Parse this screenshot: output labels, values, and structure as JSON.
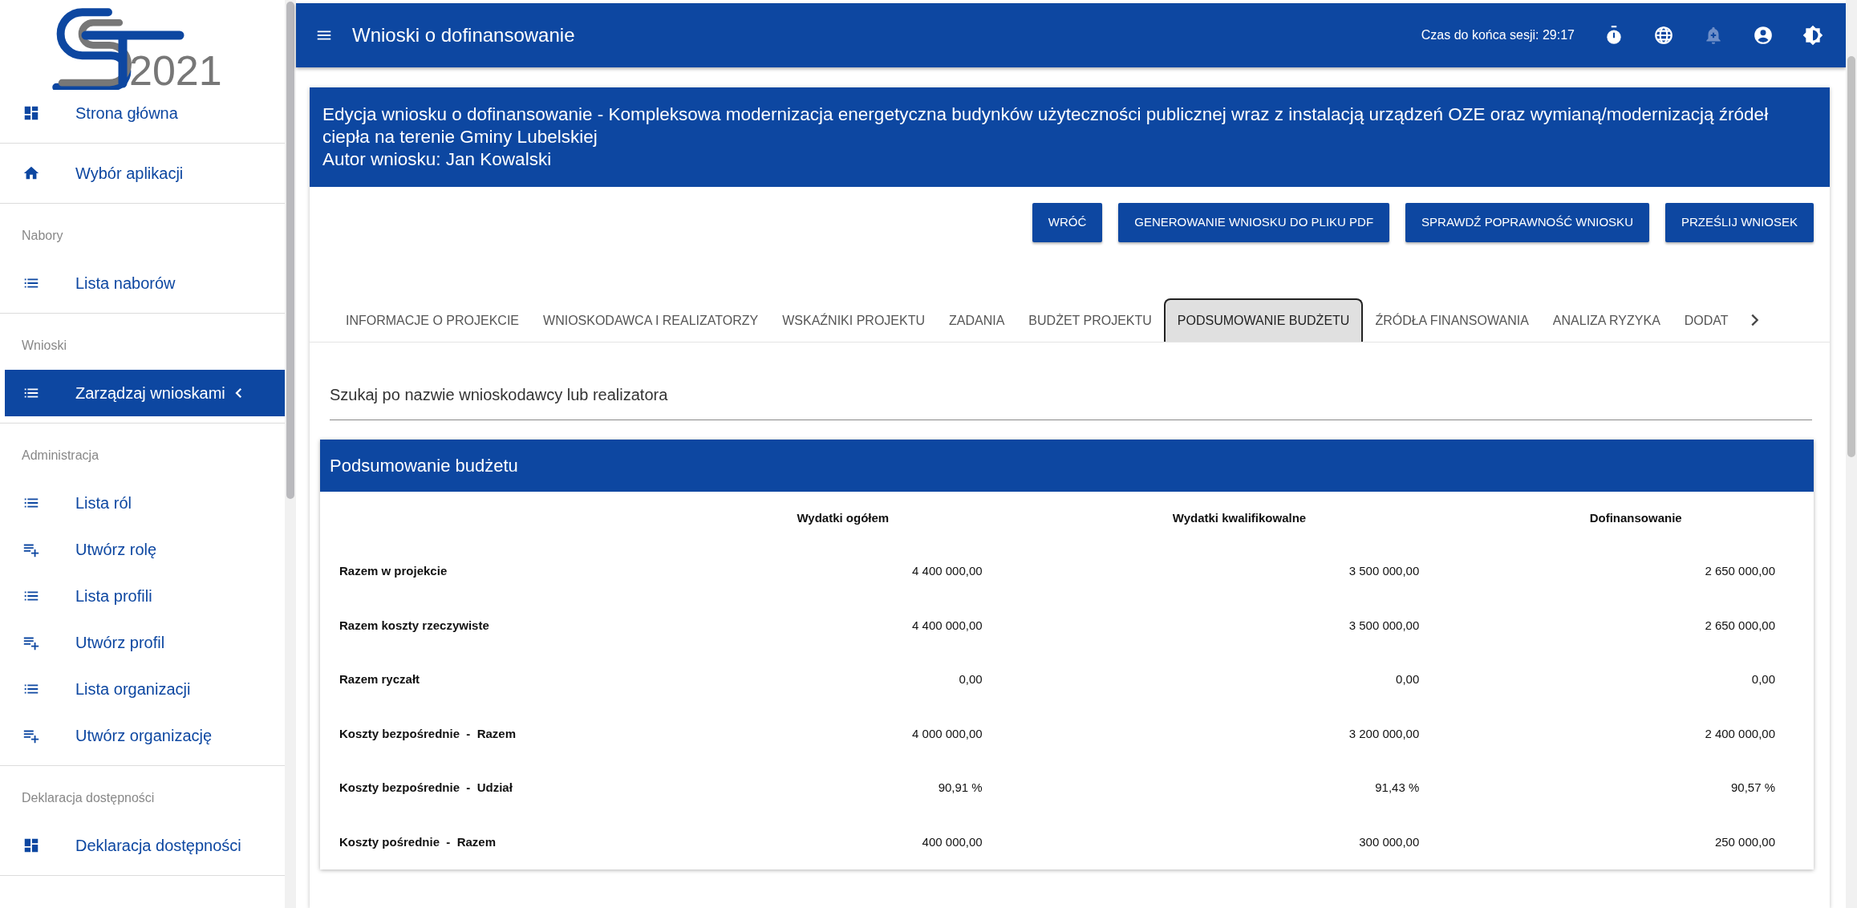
{
  "logo": {
    "text": "2021"
  },
  "sidebar": {
    "groups": [
      {
        "items": [
          {
            "kind": "dashboard",
            "label": "Strona główna",
            "selected": false,
            "has_submenu": false
          }
        ]
      },
      {
        "items": [
          {
            "kind": "home",
            "label": "Wybór aplikacji",
            "selected": false,
            "has_submenu": false
          }
        ]
      },
      {
        "header": "Nabory",
        "items": [
          {
            "kind": "list",
            "label": "Lista naborów",
            "selected": false,
            "has_submenu": false
          }
        ]
      },
      {
        "header": "Wnioski",
        "items": [
          {
            "kind": "list",
            "label": "Zarządzaj wnioskami",
            "selected": true,
            "has_submenu": true
          }
        ]
      },
      {
        "header": "Administracja",
        "items": [
          {
            "kind": "list",
            "label": "Lista ról",
            "selected": false,
            "has_submenu": false
          },
          {
            "kind": "list-add",
            "label": "Utwórz rolę",
            "selected": false,
            "has_submenu": false
          },
          {
            "kind": "list",
            "label": "Lista profili",
            "selected": false,
            "has_submenu": false
          },
          {
            "kind": "list-add",
            "label": "Utwórz profil",
            "selected": false,
            "has_submenu": false
          },
          {
            "kind": "list",
            "label": "Lista organizacji",
            "selected": false,
            "has_submenu": false
          },
          {
            "kind": "list-add",
            "label": "Utwórz organizację",
            "selected": false,
            "has_submenu": false
          }
        ]
      },
      {
        "header": "Deklaracja dostępności",
        "items": [
          {
            "kind": "dashboard",
            "label": "Deklaracja dostępności",
            "selected": false,
            "has_submenu": false
          }
        ]
      }
    ]
  },
  "topbar": {
    "title": "Wnioski o dofinansowanie",
    "session": "Czas do końca sesji: 29:17",
    "icons": [
      {
        "kind": "timer",
        "disabled": false
      },
      {
        "kind": "globe",
        "disabled": false
      },
      {
        "kind": "bell",
        "disabled": true
      },
      {
        "kind": "account",
        "disabled": false
      },
      {
        "kind": "contrast",
        "disabled": false
      }
    ]
  },
  "header": {
    "title": "Edycja wniosku o dofinansowanie - Kompleksowa modernizacja energetyczna budynków użyteczności publicznej wraz z instalacją urządzeń OZE oraz wymianą/modernizacją źródeł ciepła na terenie Gminy Lubelskiej",
    "author": "Autor wniosku: Jan Kowalski"
  },
  "buttons": [
    "WRÓĆ",
    "GENEROWANIE WNIOSKU DO PLIKU PDF",
    "SPRAWDŹ POPRAWNOŚĆ WNIOSKU",
    "PRZEŚLIJ WNIOSEK"
  ],
  "tabs": [
    {
      "label": "INFORMACJE O PROJEKCIE",
      "selected": false
    },
    {
      "label": "WNIOSKODAWCA I REALIZATORZY",
      "selected": false
    },
    {
      "label": "WSKAŹNIKI PROJEKTU",
      "selected": false
    },
    {
      "label": "ZADANIA",
      "selected": false
    },
    {
      "label": "BUDŻET PROJEKTU",
      "selected": false
    },
    {
      "label": "PODSUMOWANIE BUDŻETU",
      "selected": true
    },
    {
      "label": "ŹRÓDŁA FINANSOWANIA",
      "selected": false
    },
    {
      "label": "ANALIZA RYZYKA",
      "selected": false
    },
    {
      "label": "DODAT",
      "selected": false
    }
  ],
  "search": {
    "placeholder": "Szukaj po nazwie wnioskodawcy lub realizatora"
  },
  "panel": {
    "title": "Podsumowanie budżetu",
    "columns": [
      "Wydatki ogółem",
      "Wydatki kwalifikowalne",
      "Dofinansowanie"
    ],
    "rows": [
      {
        "label": "Razem w projekcie",
        "values": [
          "4 400 000,00",
          "3 500 000,00",
          "2 650 000,00"
        ]
      },
      {
        "label": "Razem koszty rzeczywiste",
        "values": [
          "4 400 000,00",
          "3 500 000,00",
          "2 650 000,00"
        ]
      },
      {
        "label": "Razem ryczałt",
        "values": [
          "0,00",
          "0,00",
          "0,00"
        ]
      },
      {
        "label": "Koszty bezpośrednie  -  Razem",
        "values": [
          "4 000 000,00",
          "3 200 000,00",
          "2 400 000,00"
        ]
      },
      {
        "label": "Koszty bezpośrednie  -  Udział",
        "values": [
          "90,91 %",
          "91,43 %",
          "90,57 %"
        ]
      },
      {
        "label": "Koszty pośrednie  -  Razem",
        "values": [
          "400 000,00",
          "300 000,00",
          "250 000,00"
        ]
      }
    ]
  }
}
